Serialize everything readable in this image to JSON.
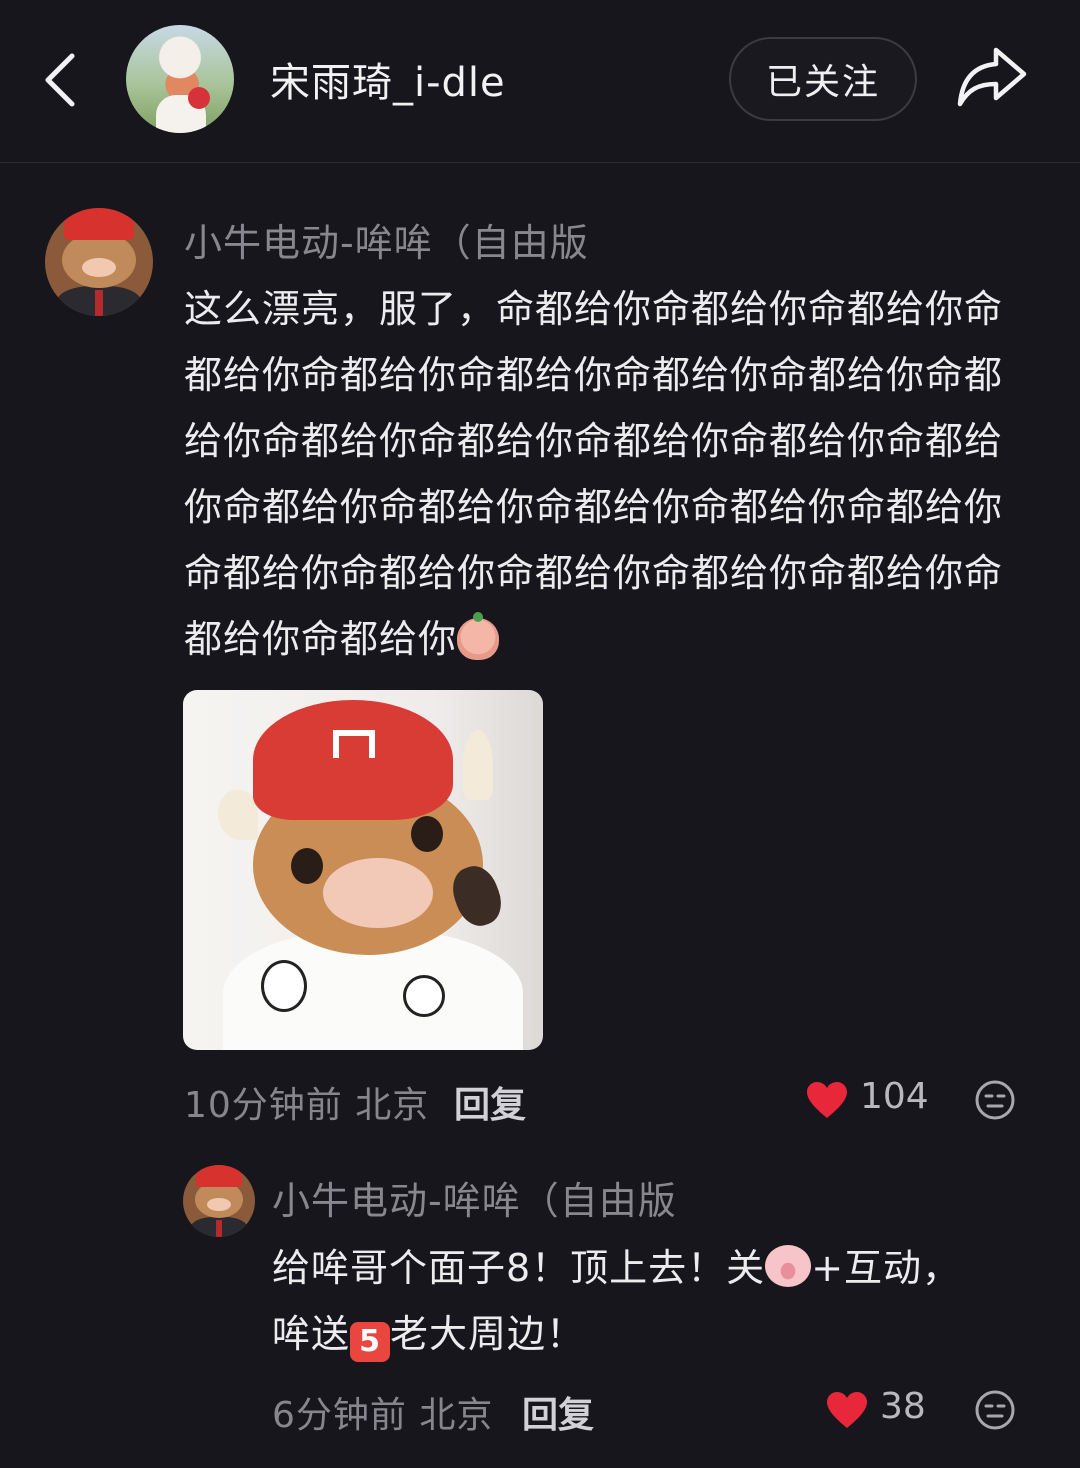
{
  "header": {
    "back_icon": "chevron-left-icon",
    "title": "宋雨琦_i-dle",
    "follow_label": "已关注",
    "share_icon": "share-arrow-icon"
  },
  "comment": {
    "author": "小牛电动-哞哞（自由版",
    "text": "这么漂亮，服了，命都给你命都给你命都给你命都给你命都给你命都给你命都给你命都给你命都给你命都给你命都给你命都给你命都给你命都给你命都给你命都给你命都给你命都给你命都给你命都给你命都给你命都给你命都给你命都给你命都给你命都给你",
    "emoji": "pig-emoji",
    "time": "10分钟前",
    "location": "北京",
    "reply_label": "回复",
    "likes": "104"
  },
  "reply": {
    "author": "小牛电动-哞哞（自由版",
    "text_part1": "给哞哥个面子8！顶上去！关",
    "text_part2": "+互动，哞送",
    "five_badge": "5",
    "text_part3": "老大周边！",
    "time": "6分钟前",
    "location": "北京",
    "reply_label": "回复",
    "likes": "38"
  },
  "colors": {
    "background": "#17161c",
    "like_red": "#e8273a"
  }
}
